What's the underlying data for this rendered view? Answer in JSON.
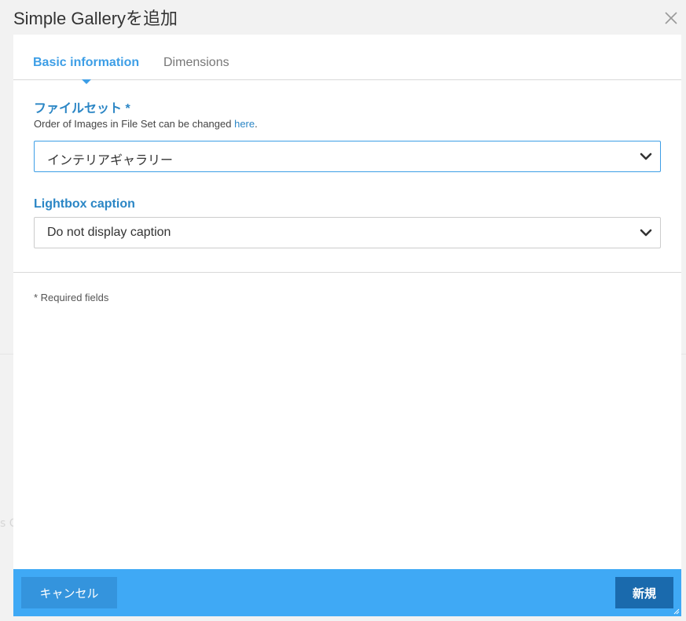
{
  "dialog": {
    "title": "Simple Galleryを追加",
    "close_icon": "close-icon"
  },
  "tabs": [
    {
      "label": "Basic information",
      "active": true
    },
    {
      "label": "Dimensions",
      "active": false
    }
  ],
  "fields": {
    "file_set": {
      "label": "ファイルセット *",
      "help_prefix": "Order of Images in File Set can be changed ",
      "help_link": "here",
      "help_suffix": ".",
      "value": "インテリアギャラリー"
    },
    "lightbox_caption": {
      "label": "Lightbox caption",
      "value": "Do not display caption"
    }
  },
  "required_note": "* Required fields",
  "footer": {
    "cancel_label": "キャンセル",
    "submit_label": "新規"
  },
  "colors": {
    "accent": "#3d9ee6",
    "label": "#2b86c5",
    "footer_bg": "#3fa9f5",
    "cancel_bg": "#3494dd",
    "submit_bg": "#1a6aad"
  }
}
